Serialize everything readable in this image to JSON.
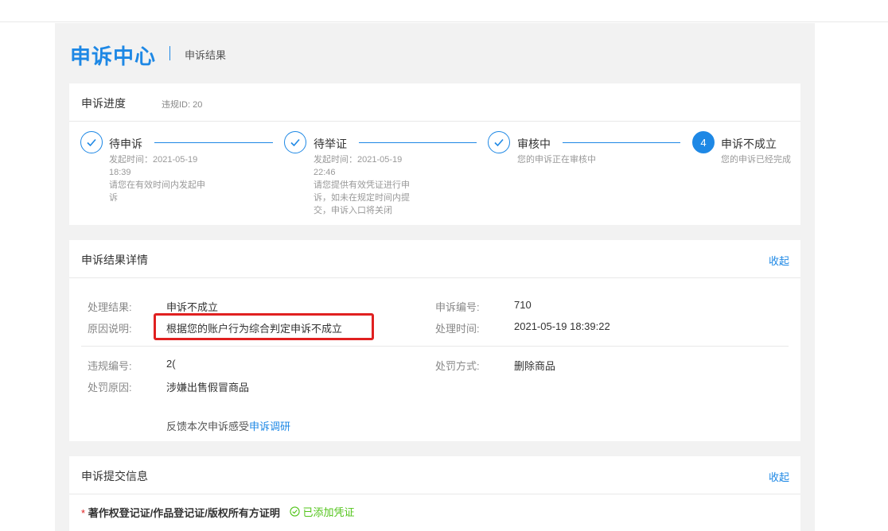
{
  "header": {
    "title": "申诉中心",
    "subtitle": "申诉结果"
  },
  "progress": {
    "title": "申诉进度",
    "violation_id_label": "违规ID: 20",
    "steps": [
      {
        "title": "待申诉",
        "desc_lines": [
          "发起时间：2021-05-19",
          "18:39",
          "请您在有效时间内发起申",
          "诉"
        ],
        "state": "done",
        "icon": "check-icon"
      },
      {
        "title": "待举证",
        "desc_lines": [
          "发起时间：2021-05-19",
          "22:46",
          "请您提供有效凭证进行申",
          "诉，如未在规定时间内提",
          "交，申诉入口将关闭"
        ],
        "state": "done",
        "icon": "check-icon"
      },
      {
        "title": "审核中",
        "desc_lines": [
          "您的申诉正在审核中"
        ],
        "state": "done",
        "icon": "check-icon"
      },
      {
        "title": "申诉不成立",
        "number": "4",
        "desc_lines": [
          "您的申诉已经完成"
        ],
        "state": "active"
      }
    ]
  },
  "result": {
    "title": "申诉结果详情",
    "collapse_label": "收起",
    "fields": {
      "result_label": "处理结果:",
      "result_value": "申诉不成立",
      "reason_label": "原因说明:",
      "reason_value": "根据您的账户行为综合判定申诉不成立",
      "appeal_no_label": "申诉编号:",
      "appeal_no_value": "710",
      "process_time_label": "处理时间:",
      "process_time_value": "2021-05-19 18:39:22",
      "violation_no_label": "违规编号:",
      "violation_no_value": "2(",
      "penalty_method_label": "处罚方式:",
      "penalty_method_value": "删除商品",
      "penalty_reason_label": "处罚原因:",
      "penalty_reason_value": "涉嫌出售假冒商品"
    },
    "feedback_text": "反馈本次申诉感受",
    "feedback_link": "申诉调研"
  },
  "submission": {
    "title": "申诉提交信息",
    "collapse_label": "收起",
    "required_mark": "*",
    "evidence_title": "著作权登记证/作品登记证/版权所有方证明",
    "evidence_status": "已添加凭证"
  },
  "colors": {
    "accent": "#1e88e5",
    "highlight": "#e02020",
    "success": "#52c41a"
  }
}
